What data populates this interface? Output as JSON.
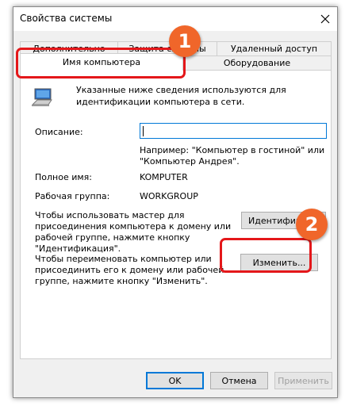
{
  "window": {
    "title": "Свойства системы"
  },
  "tabs": {
    "row_back": [
      "Дополнительно",
      "Защита системы",
      "Удаленный доступ"
    ],
    "active": "Имя компьютера",
    "hardware": "Оборудование"
  },
  "panel": {
    "intro_line1": "Указанные ниже сведения используются для",
    "intro_line2": "идентификации компьютера в сети.",
    "description_label": "Описание:",
    "description_value": "",
    "example_line1": "Например: \"Компьютер в гостиной\" или",
    "example_line2": "\"Компьютер Андрея\".",
    "fullname_label": "Полное имя:",
    "fullname_value": "KOMPUTER",
    "workgroup_label": "Рабочая группа:",
    "workgroup_value": "WORKGROUP",
    "wizard_line1": "Чтобы использовать мастер для",
    "wizard_line2": "присоединения компьютера к домену или",
    "wizard_line3": "рабочей группе, нажмите кнопку",
    "wizard_line4": "\"Идентификация\".",
    "ident_button": "Идентификация...",
    "rename_line1": "Чтобы переименовать компьютер или",
    "rename_line2": "присоединить его к домену или рабочей",
    "rename_line3": "группе, нажмите кнопку \"Изменить\".",
    "change_button": "Изменить..."
  },
  "footer": {
    "ok": "OK",
    "cancel": "Отмена",
    "apply": "Применить"
  },
  "annotations": {
    "badge1": "1",
    "badge2": "2",
    "highlight_color": "#e4171a",
    "badge_color": "#f0662a"
  }
}
